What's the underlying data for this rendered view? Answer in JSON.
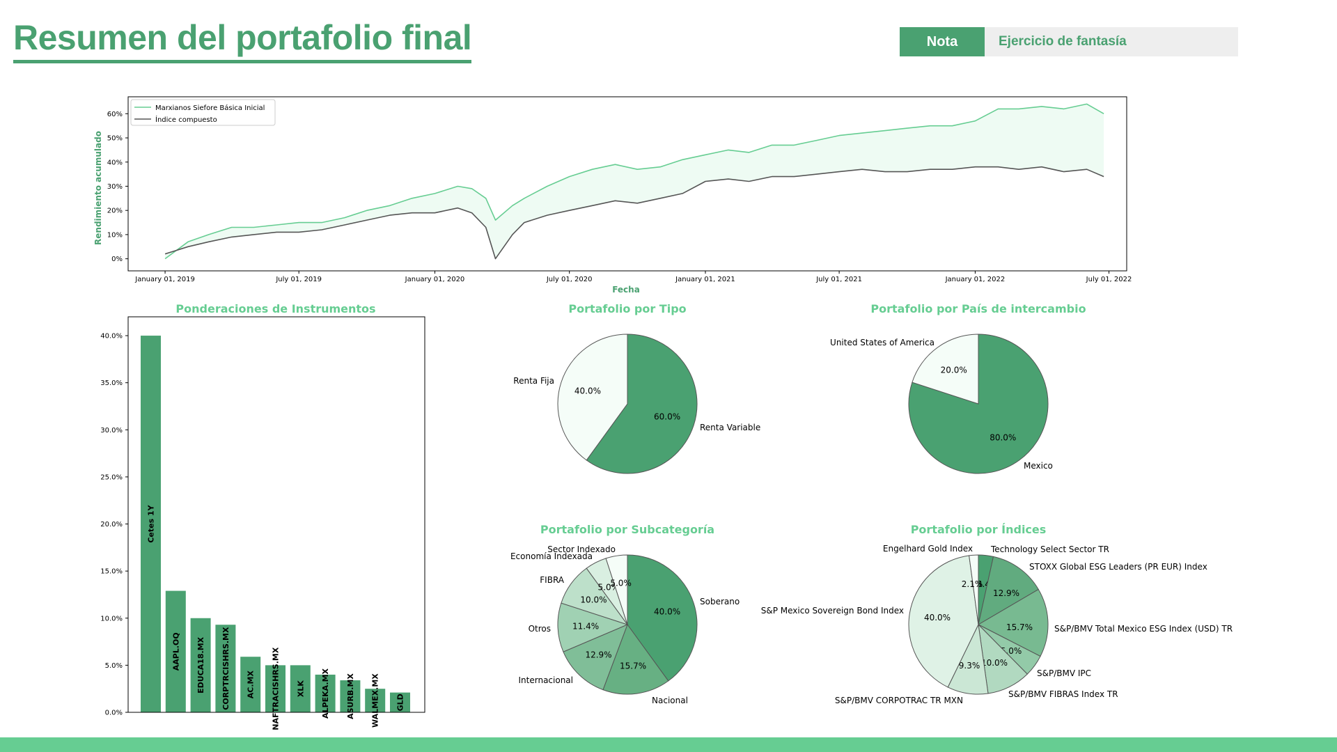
{
  "header": {
    "title": "Resumen del portafolio final",
    "note_label": "Nota",
    "note_text": "Ejercicio de fantasía"
  },
  "colors": {
    "brand_green": "#4aa171",
    "title_green": "#66cd92",
    "footer_green": "#66cd92",
    "series_portfolio": "#66cd92",
    "series_index": "#555555",
    "fill_between": "#eefbf3"
  },
  "chart_data": [
    {
      "type": "line",
      "title": "",
      "xlabel": "Fecha",
      "ylabel": "Rendimiento acumulado",
      "x_ticks": [
        "January 01, 2019",
        "July 01, 2019",
        "January 01, 2020",
        "July 01, 2020",
        "January 01, 2021",
        "July 01, 2021",
        "January 01, 2022",
        "July 01, 2022"
      ],
      "y_ticks": [
        "0%",
        "10%",
        "20%",
        "30%",
        "40%",
        "50%",
        "60%"
      ],
      "ylim": [
        -0.05,
        0.67
      ],
      "xlim": [
        "2018-11-12",
        "2022-07-25"
      ],
      "legend": "top-left",
      "grid": false,
      "fill_between": true,
      "x": [
        "2019-01-01",
        "2019-02-01",
        "2019-03-01",
        "2019-04-01",
        "2019-05-01",
        "2019-06-01",
        "2019-07-01",
        "2019-08-01",
        "2019-09-01",
        "2019-10-01",
        "2019-11-01",
        "2019-12-01",
        "2020-01-01",
        "2020-02-01",
        "2020-02-20",
        "2020-03-10",
        "2020-03-23",
        "2020-04-15",
        "2020-05-01",
        "2020-06-01",
        "2020-07-01",
        "2020-08-01",
        "2020-09-01",
        "2020-10-01",
        "2020-11-01",
        "2020-12-01",
        "2021-01-01",
        "2021-02-01",
        "2021-03-01",
        "2021-04-01",
        "2021-05-01",
        "2021-06-01",
        "2021-07-01",
        "2021-08-01",
        "2021-09-01",
        "2021-10-01",
        "2021-11-01",
        "2021-12-01",
        "2022-01-01",
        "2022-02-01",
        "2022-03-01",
        "2022-04-01",
        "2022-05-01",
        "2022-06-01",
        "2022-06-24"
      ],
      "series": [
        {
          "name": "Marxianos Siefore Básica Inicial",
          "values": [
            0.0,
            0.07,
            0.1,
            0.13,
            0.13,
            0.14,
            0.15,
            0.15,
            0.17,
            0.2,
            0.22,
            0.25,
            0.27,
            0.3,
            0.29,
            0.25,
            0.16,
            0.22,
            0.25,
            0.3,
            0.34,
            0.37,
            0.39,
            0.37,
            0.38,
            0.41,
            0.43,
            0.45,
            0.44,
            0.47,
            0.47,
            0.49,
            0.51,
            0.52,
            0.53,
            0.54,
            0.55,
            0.55,
            0.57,
            0.62,
            0.62,
            0.63,
            0.62,
            0.64,
            0.6
          ]
        },
        {
          "name": "Índice compuesto",
          "values": [
            0.02,
            0.05,
            0.07,
            0.09,
            0.1,
            0.11,
            0.11,
            0.12,
            0.14,
            0.16,
            0.18,
            0.19,
            0.19,
            0.21,
            0.19,
            0.13,
            0.0,
            0.1,
            0.15,
            0.18,
            0.2,
            0.22,
            0.24,
            0.23,
            0.25,
            0.27,
            0.32,
            0.33,
            0.32,
            0.34,
            0.34,
            0.35,
            0.36,
            0.37,
            0.36,
            0.36,
            0.37,
            0.37,
            0.38,
            0.38,
            0.37,
            0.38,
            0.36,
            0.37,
            0.34
          ]
        }
      ]
    },
    {
      "type": "bar",
      "title": "Ponderaciones de Instrumentos",
      "categories": [
        "Cetes 1Y",
        "AAPL.OQ",
        "EDUCA18.MX",
        "CORPTRCISHRS.MX",
        "AC.MX",
        "NAFTRACISHRS.MX",
        "XLK",
        "ALPEKA.MX",
        "ASURB.MX",
        "WALMEX.MX",
        "GLD"
      ],
      "values": [
        40.0,
        12.9,
        10.0,
        9.3,
        5.9,
        5.0,
        5.0,
        4.0,
        3.4,
        2.5,
        2.1
      ],
      "y_ticks": [
        "0.0%",
        "5.0%",
        "10.0%",
        "15.0%",
        "20.0%",
        "25.0%",
        "30.0%",
        "35.0%",
        "40.0%"
      ],
      "ylim": [
        0,
        42
      ]
    },
    {
      "type": "pie",
      "title": "Portafolio por Tipo",
      "labels": [
        "Renta Variable",
        "Renta Fija"
      ],
      "values": [
        60.0,
        40.0
      ],
      "pct_labels": [
        "60.0%",
        "40.0%"
      ],
      "colors": [
        "#4aa171",
        "#f5fdf8"
      ]
    },
    {
      "type": "pie",
      "title": "Portafolio por País de intercambio",
      "labels": [
        "Mexico",
        "United States of America"
      ],
      "values": [
        80.0,
        20.0
      ],
      "pct_labels": [
        "80.0%",
        "20.0%"
      ],
      "colors": [
        "#4aa171",
        "#f5fdf8"
      ]
    },
    {
      "type": "pie",
      "title": "Portafolio por Subcategoría",
      "labels": [
        "Soberano",
        "Nacional",
        "Internacional",
        "Otros",
        "FIBRA",
        "Economía Indexada",
        "Sector Indexado"
      ],
      "values": [
        40.0,
        15.7,
        12.9,
        11.4,
        10.0,
        5.0,
        5.0
      ],
      "pct_labels": [
        "40.0%",
        "15.7%",
        "12.9%",
        "11.4%",
        "10.0%",
        "5.0%",
        "5.0%"
      ],
      "colors": [
        "#4aa171",
        "#67b083",
        "#80be98",
        "#a0d1b3",
        "#bde0ca",
        "#d9efe1",
        "#f5fdf8"
      ]
    },
    {
      "type": "pie",
      "title": "Portafolio por Índices",
      "labels": [
        "Technology Select Sector TR",
        "STOXX Global ESG Leaders (PR EUR) Index",
        "S&P/BMV Total Mexico ESG Index (USD) TR",
        "S&P/BMV IPC",
        "S&P/BMV FIBRAS Index TR",
        "S&P/BMV CORPOTRAC TR MXN",
        "S&P Mexico Sovereign Bond Index",
        "Engelhard Gold Index"
      ],
      "values": [
        3.4,
        12.9,
        15.7,
        5.0,
        10.0,
        9.3,
        40.0,
        2.1
      ],
      "pct_labels": [
        "3.4%",
        "12.9%",
        "15.7%",
        "5.0%",
        "10.0%",
        "9.3%",
        "40.0%",
        "2.1%"
      ],
      "colors": [
        "#4aa171",
        "#61ab7f",
        "#78ba91",
        "#93caa8",
        "#b1d9c0",
        "#cbe7d5",
        "#dff2e6",
        "#f5fdf8"
      ]
    }
  ]
}
